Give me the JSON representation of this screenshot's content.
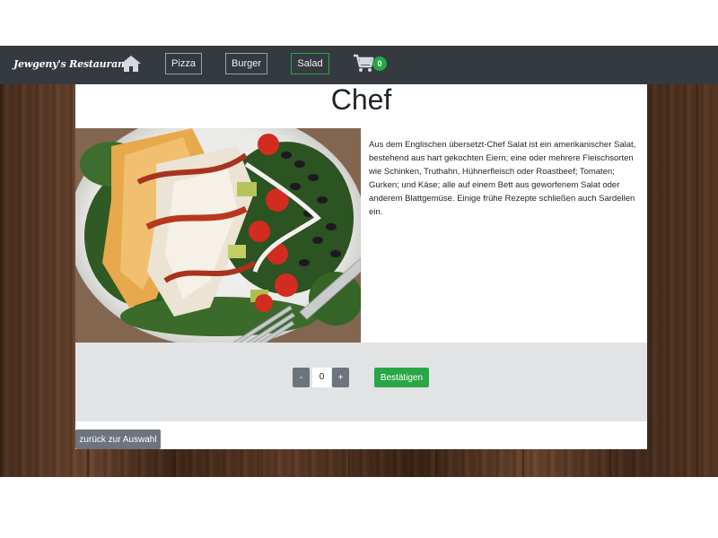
{
  "navbar": {
    "brand": "Jewgeny's Restaurant",
    "home_icon": "home-icon",
    "items": [
      {
        "label": "Pizza",
        "active": false
      },
      {
        "label": "Burger",
        "active": false
      },
      {
        "label": "Salad",
        "active": true
      }
    ],
    "cart_icon": "cart-icon",
    "cart_count": "0"
  },
  "dish": {
    "title": "Chef",
    "image": "chef-salad-photo",
    "description": "Aus dem Englischen übersetzt-Chef Salat ist ein amerikanischer Salat, bestehend aus hart gekochten Eiern; eine oder mehrere Fleischsorten wie Schinken, Truthahn, Hühnerfleisch oder Roastbeef; Tomaten; Gurken; und Käse; alle auf einem Bett aus geworfenem Salat oder anderem Blattgemüse. Einige frühe Rezepte schließen auch Sardellen ein."
  },
  "order": {
    "decrement_label": "-",
    "quantity": "0",
    "increment_label": "+",
    "confirm_label": "Bestätigen"
  },
  "back_label": "zurück zur Auswahl",
  "colors": {
    "navbar": "#343a40",
    "active_border": "#28a745",
    "success": "#28a745",
    "secondary": "#6c757d",
    "panel": "#e2e3e5"
  }
}
